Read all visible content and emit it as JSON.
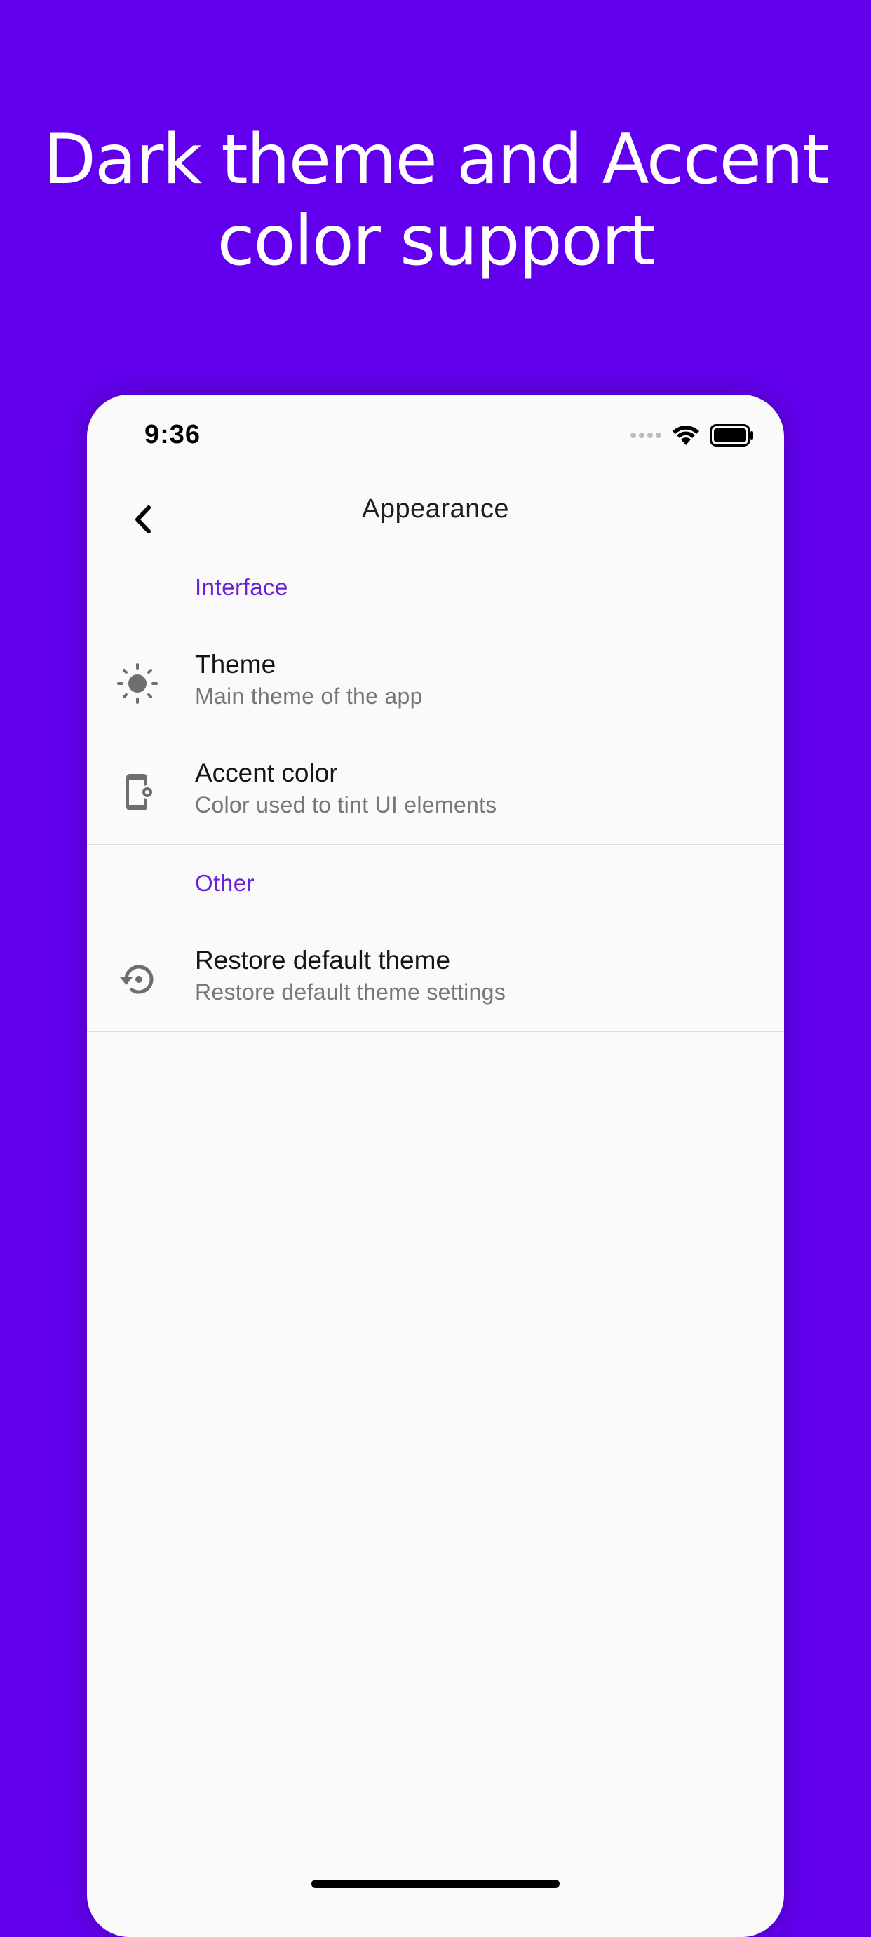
{
  "headline": {
    "line1": "Dark theme and Accent",
    "line2": "color support"
  },
  "status_bar": {
    "time": "9:36",
    "icons": [
      "cellular-dots-icon",
      "wifi-icon",
      "battery-icon"
    ]
  },
  "app_bar": {
    "title": "Appearance",
    "back_icon": "chevron-left-icon"
  },
  "sections": [
    {
      "header": "Interface",
      "items": [
        {
          "icon": "sun-icon",
          "title": "Theme",
          "subtitle": "Main theme of the app"
        },
        {
          "icon": "phone-settings-icon",
          "title": "Accent color",
          "subtitle": "Color used to tint UI elements"
        }
      ]
    },
    {
      "header": "Other",
      "items": [
        {
          "icon": "restore-icon",
          "title": "Restore default theme",
          "subtitle": "Restore default theme settings"
        }
      ]
    }
  ],
  "colors": {
    "background": "#6200EE",
    "accent": "#6A1FD8",
    "surface": "#FAFAFA"
  }
}
